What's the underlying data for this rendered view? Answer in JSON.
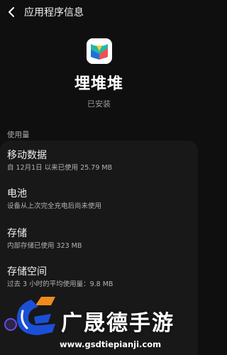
{
  "header": {
    "back_icon": "back-arrow-icon",
    "title": "应用程序信息"
  },
  "app": {
    "name": "埋堆堆",
    "status": "已安装",
    "icon": "app-icon"
  },
  "usage_section": {
    "label": "使用量",
    "items": [
      {
        "title": "移动数据",
        "subtitle": "自 12月1日 以来已使用 25.79 MB"
      },
      {
        "title": "电池",
        "subtitle": "设备从上次完全充电后尚未使用"
      },
      {
        "title": "存储",
        "subtitle": "内部存储已使用 323 MB"
      },
      {
        "title": "存储空间",
        "subtitle": "过去 3 小时的平均使用量：9.8 MB"
      }
    ]
  },
  "watermark": {
    "text": "广晟德手游",
    "url": "www.gsdtiepianji.com",
    "logo_icon": "gsd-logo-icon"
  },
  "colors": {
    "background": "#0f0f0f",
    "card": "#181818",
    "watermark_blue": "#1b4fd6",
    "watermark_orange": "#f08a1c"
  }
}
